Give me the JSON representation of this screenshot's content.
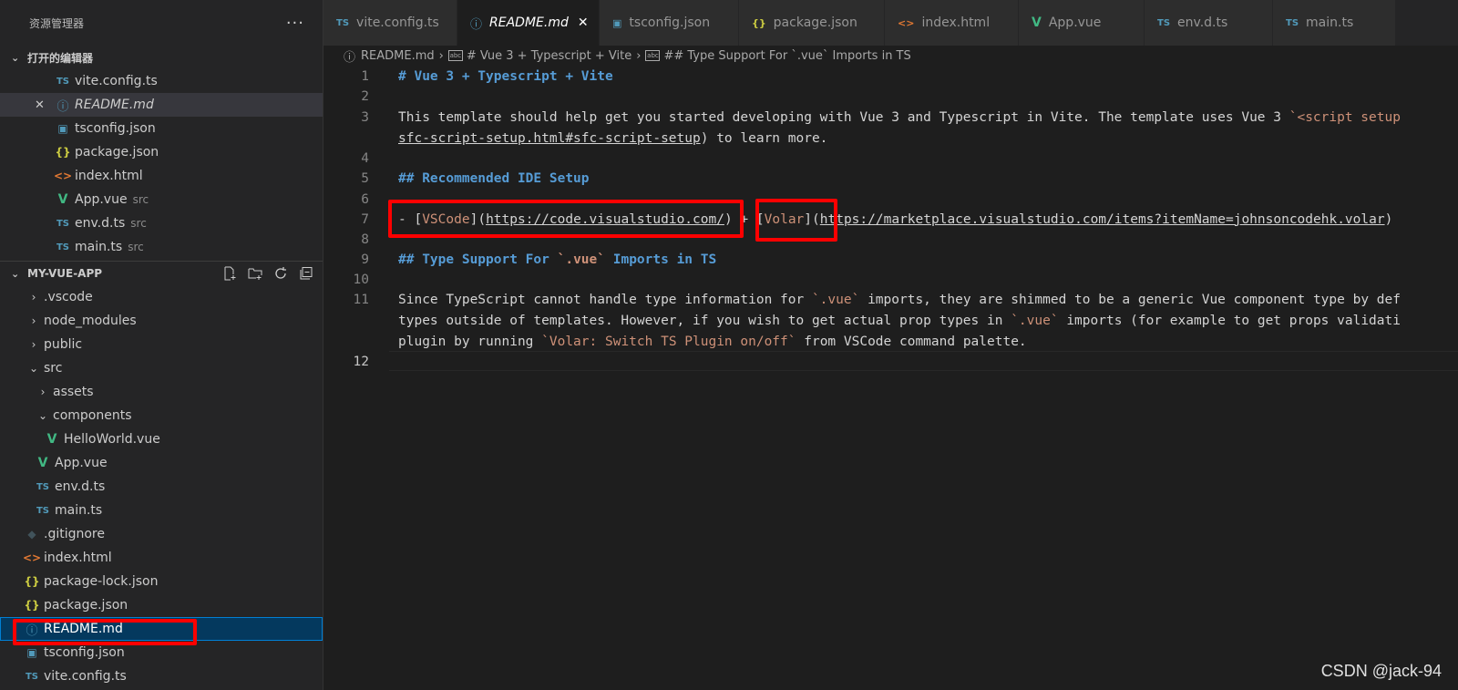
{
  "sidebar": {
    "title": "资源管理器",
    "more": "···",
    "open_editors": {
      "title": "打开的编辑器",
      "items": [
        {
          "label": "vite.config.ts",
          "icon": "TS",
          "hint": ""
        },
        {
          "label": "README.md",
          "icon": "ⓘ",
          "hint": "",
          "close": "✕"
        },
        {
          "label": "tsconfig.json",
          "icon": "▣",
          "hint": ""
        },
        {
          "label": "package.json",
          "icon": "{}",
          "hint": ""
        },
        {
          "label": "index.html",
          "icon": "<>",
          "hint": ""
        },
        {
          "label": "App.vue",
          "icon": "V",
          "hint": "src"
        },
        {
          "label": "env.d.ts",
          "icon": "TS",
          "hint": "src"
        },
        {
          "label": "main.ts",
          "icon": "TS",
          "hint": "src"
        }
      ]
    },
    "project": {
      "title": "MY-VUE-APP",
      "tree": [
        {
          "label": ".vscode",
          "caret": "›"
        },
        {
          "label": "node_modules",
          "caret": "›"
        },
        {
          "label": "public",
          "caret": "›"
        },
        {
          "label": "src",
          "caret": "⌄"
        },
        {
          "label": "assets",
          "caret": "›"
        },
        {
          "label": "components",
          "caret": "⌄"
        },
        {
          "label": "HelloWorld.vue",
          "icon": "V"
        },
        {
          "label": "App.vue",
          "icon": "V"
        },
        {
          "label": "env.d.ts",
          "icon": "TS"
        },
        {
          "label": "main.ts",
          "icon": "TS"
        },
        {
          "label": ".gitignore",
          "icon": "◆"
        },
        {
          "label": "index.html",
          "icon": "<>"
        },
        {
          "label": "package-lock.json",
          "icon": "{}"
        },
        {
          "label": "package.json",
          "icon": "{}"
        },
        {
          "label": "README.md",
          "icon": "ⓘ"
        },
        {
          "label": "tsconfig.json",
          "icon": "▣"
        },
        {
          "label": "vite.config.ts",
          "icon": "TS"
        }
      ]
    }
  },
  "tabs": [
    {
      "label": "vite.config.ts",
      "icon": "TS"
    },
    {
      "label": "README.md",
      "icon": "ⓘ",
      "close": "✕"
    },
    {
      "label": "tsconfig.json",
      "icon": "▣"
    },
    {
      "label": "package.json",
      "icon": "{}"
    },
    {
      "label": "index.html",
      "icon": "<>"
    },
    {
      "label": "App.vue",
      "icon": "V"
    },
    {
      "label": "env.d.ts",
      "icon": "TS"
    },
    {
      "label": "main.ts",
      "icon": "TS"
    }
  ],
  "breadcrumb": {
    "file": "README.md",
    "h1": "# Vue 3 + Typescript + Vite",
    "h2": "## Type Support For `.vue` Imports in TS",
    "sym_icon": "abc",
    "sep": "›"
  },
  "editor": {
    "line_numbers": [
      "1",
      "2",
      "3",
      "4",
      "5",
      "6",
      "7",
      "8",
      "9",
      "10",
      "11",
      "12"
    ],
    "l1": "# Vue 3 + Typescript + Vite",
    "l3a": "This template should help get you started developing with Vue 3 and Typescript in Vite. The template uses Vue 3 ",
    "l3b": "`<script setup",
    "l3c": "sfc-script-setup.html#sfc-script-setup",
    "l3d": ") to learn more.",
    "l5": "## Recommended IDE Setup",
    "l7_dash": "- ",
    "l7_b1": "[",
    "l7_vscode": "VSCode",
    "l7_b2": "](",
    "l7_url1": "https://code.visualstudio.com/",
    "l7_p1": ")",
    "l7_plus": " + ",
    "l7_volar": "Volar",
    "l7_url2": "https://marketplace.visualstudio.com/items?itemName=johnsoncodehk.volar",
    "l9a": "## Type Support For ",
    "l9b": "`.vue`",
    "l9c": " Imports in TS",
    "l11a1": "Since TypeScript cannot handle type information for ",
    "l11a2": "`.vue`",
    "l11a3": " imports, they are shimmed to be a generic Vue component type by def",
    "l11b1": "types outside of templates. However, if you wish to get actual prop types in ",
    "l11b2": "`.vue`",
    "l11b3": " imports (for example to get props validati",
    "l11c1": "plugin by running ",
    "l11c2": "`Volar: Switch TS Plugin on/off`",
    "l11c3": " from VSCode command palette."
  },
  "watermark": "CSDN @jack-94",
  "colors": {
    "annotation": "#ff0000",
    "selection": "#04395e",
    "accent": "#007fd4"
  }
}
